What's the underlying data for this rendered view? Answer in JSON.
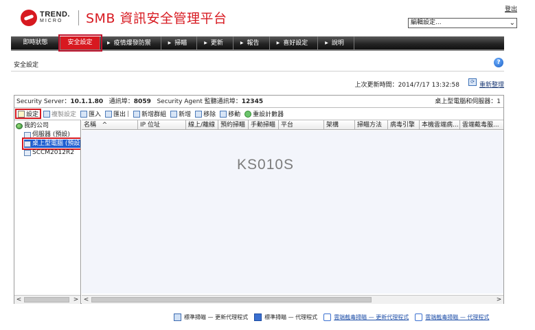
{
  "header": {
    "logo_top": "TREND.",
    "logo_bottom": "MICRO",
    "title": "SMB 資訊安全管理平台",
    "logout": "登出",
    "settings_select": "編輯設定..."
  },
  "nav": {
    "items": [
      {
        "label": "即時狀態"
      },
      {
        "label": "安全設定"
      },
      {
        "label": "疫情爆發防禦"
      },
      {
        "label": "掃瞄"
      },
      {
        "label": "更新"
      },
      {
        "label": "報告"
      },
      {
        "label": "喜好設定"
      },
      {
        "label": "說明"
      }
    ],
    "active_index": 1
  },
  "page": {
    "title": "安全設定",
    "last_update_label": "上次更新時間：",
    "last_update_value": "2014/7/17 13:32:58",
    "refresh_label": "重新整理"
  },
  "info_bar": {
    "server_label": "Security Server：",
    "server_value": "10.1.1.80",
    "port_label": "通訊埠：",
    "port_value": "8059",
    "agent_port_label": "Security Agent 監聽通訊埠：",
    "agent_port_value": "12345",
    "right_text": "桌上型電腦和伺服器：1"
  },
  "toolbar": {
    "configure": "設定",
    "copy_settings": "複製設定",
    "import": "匯入",
    "export": "匯出",
    "add_group": "新增群組",
    "add": "新增",
    "remove": "移除",
    "move": "移動",
    "reset_counters": "重設計數器"
  },
  "tree": {
    "root": "我的公司",
    "items": [
      "伺服器 (預設)",
      "桌上型電腦 (預設)",
      "SCCM2012R2"
    ]
  },
  "grid": {
    "columns": [
      "名稱",
      "IP 位址",
      "線上/離線",
      "預約掃瞄",
      "手動掃瞄",
      "平台",
      "架構",
      "掃瞄方法",
      "病毒引擎",
      "本機雲端病...",
      "雲端截毒服..."
    ],
    "sort_indicator": "^",
    "watermark": "KS010S"
  },
  "legend": {
    "standard_update": "標準掃瞄 — 更新代理程式",
    "standard_agent": "標準掃瞄 — 代理程式",
    "smart_update": "雲端截毒掃瞄 — 更新代理程式",
    "smart_agent": "雲端截毒掃瞄 — 代理程式"
  },
  "colors": {
    "brand_red": "#d71920",
    "selection_blue": "#1f5fd1",
    "nav_dark": "#222222"
  }
}
